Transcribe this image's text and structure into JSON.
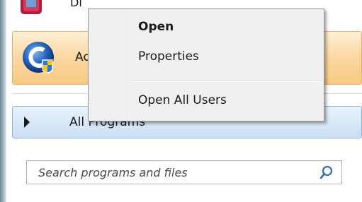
{
  "programs": {
    "top_item_partial": "Di",
    "selected_item_partial": "Ac",
    "all_programs": "All Programs"
  },
  "search": {
    "placeholder": "Search programs and files"
  },
  "context_menu": {
    "items": [
      {
        "label": "Open",
        "bold": true
      },
      {
        "label": "Properties",
        "bold": false
      },
      {
        "label": "Open All Users",
        "bold": false
      }
    ]
  },
  "icons": {
    "top_program": "program-app-icon",
    "selected_program": "shield-app-icon",
    "all_programs_arrow": "arrow-right-icon",
    "search": "search-icon"
  },
  "colors": {
    "selection": "#fbd9a4",
    "all_programs_bg": "#c9dff4",
    "menu_bg": "#f0f0f0"
  }
}
